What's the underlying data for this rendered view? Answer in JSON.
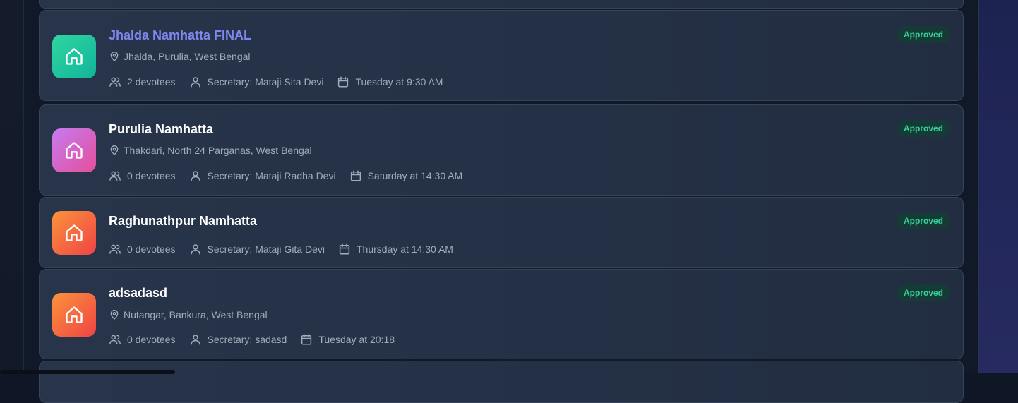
{
  "colors": {
    "title_link": "#8187f0",
    "badge_text": "#34d399",
    "badge_bg": "#163a36",
    "card_bg": "#263248"
  },
  "icons": {
    "tile": "home-icon",
    "location": "map-pin-icon",
    "devotees": "users-icon",
    "secretary": "user-icon",
    "schedule": "calendar-icon"
  },
  "namhattas": [
    {
      "name": "Jhalda Namhatta FINAL",
      "location": "Jhalda, Purulia, West Bengal",
      "devotees": "2 devotees",
      "secretary": "Secretary: Mataji Sita Devi",
      "schedule": "Tuesday at 9:30 AM",
      "status": "Approved"
    },
    {
      "name": "Purulia Namhatta",
      "location": "Thakdari, North 24 Parganas, West Bengal",
      "devotees": "0 devotees",
      "secretary": "Secretary: Mataji Radha Devi",
      "schedule": "Saturday at 14:30 AM",
      "status": "Approved"
    },
    {
      "name": "Raghunathpur Namhatta",
      "devotees": "0 devotees",
      "secretary": "Secretary: Mataji Gita Devi",
      "schedule": "Thursday at 14:30 AM",
      "status": "Approved"
    },
    {
      "name": "adsadasd",
      "location": "Nutangar, Bankura, West Bengal",
      "devotees": "0 devotees",
      "secretary": "Secretary: sadasd",
      "schedule": "Tuesday at 20:18",
      "status": "Approved"
    }
  ]
}
